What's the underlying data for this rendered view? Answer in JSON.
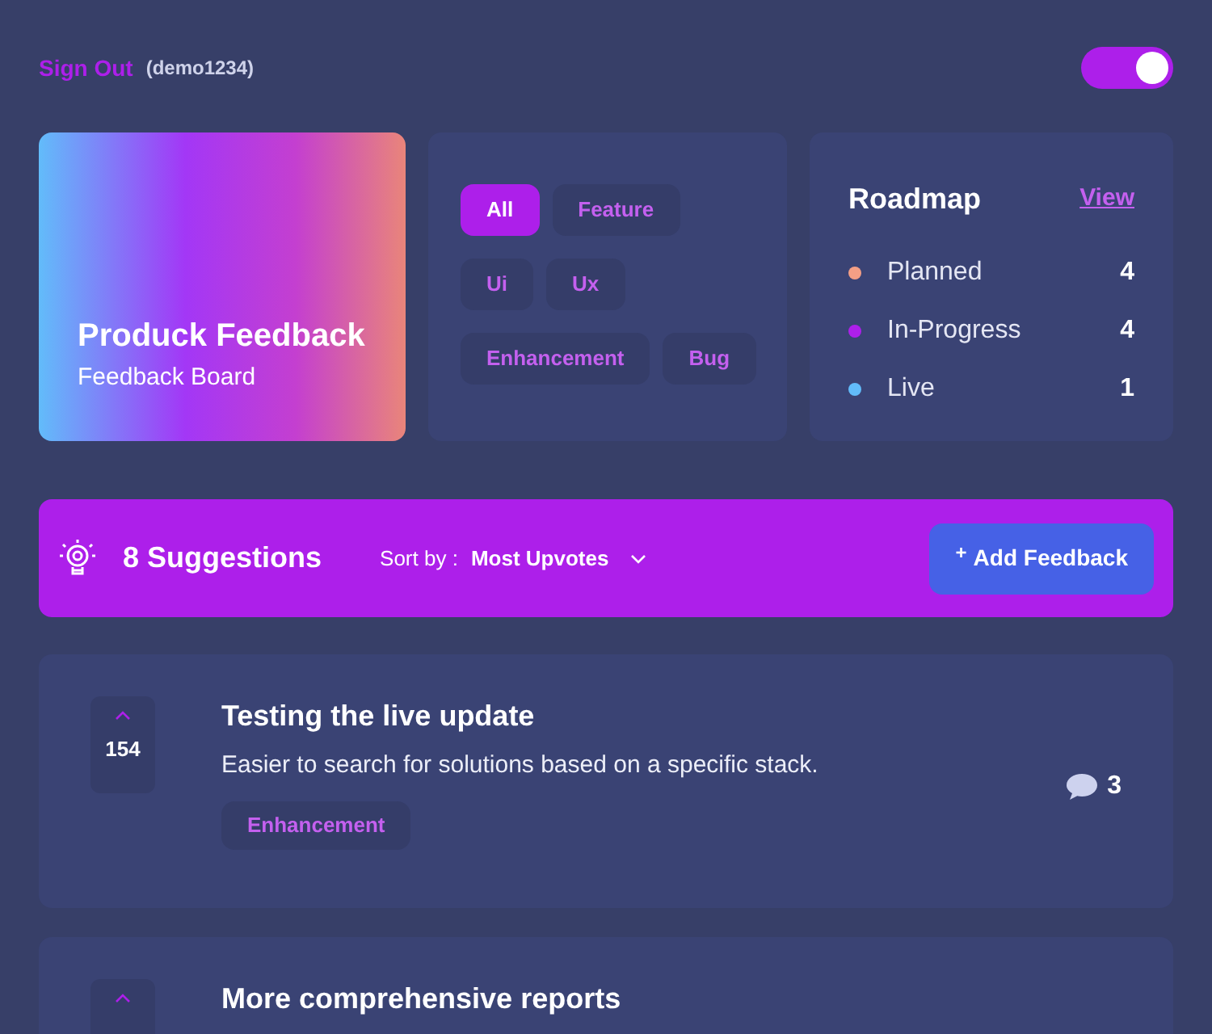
{
  "header": {
    "sign_out": "Sign Out",
    "username": "(demo1234)",
    "theme_toggle": {
      "on": true
    }
  },
  "board": {
    "title": "Produck Feedback",
    "subtitle": "Feedback Board"
  },
  "filters": [
    {
      "label": "All",
      "selected": true
    },
    {
      "label": "Feature",
      "selected": false
    },
    {
      "label": "Ui",
      "selected": false
    },
    {
      "label": "Ux",
      "selected": false
    },
    {
      "label": "Enhancement",
      "selected": false
    },
    {
      "label": "Bug",
      "selected": false
    }
  ],
  "roadmap": {
    "title": "Roadmap",
    "link": "View",
    "items": [
      {
        "label": "Planned",
        "count": "4",
        "color": "#f49f85"
      },
      {
        "label": "In-Progress",
        "count": "4",
        "color": "#ad1fea"
      },
      {
        "label": "Live",
        "count": "1",
        "color": "#62bcfa"
      }
    ]
  },
  "toolbar": {
    "count": "8 Suggestions",
    "sort_label": "Sort by :",
    "sort_value": "Most Upvotes",
    "add_button": "Add Feedback",
    "add_icon": "+"
  },
  "suggestions": [
    {
      "title": "Testing the live update",
      "description": "Easier to search for solutions based on a specific stack.",
      "tag": "Enhancement",
      "upvotes": "154",
      "comments": "3"
    },
    {
      "title": "More comprehensive reports"
    }
  ]
}
